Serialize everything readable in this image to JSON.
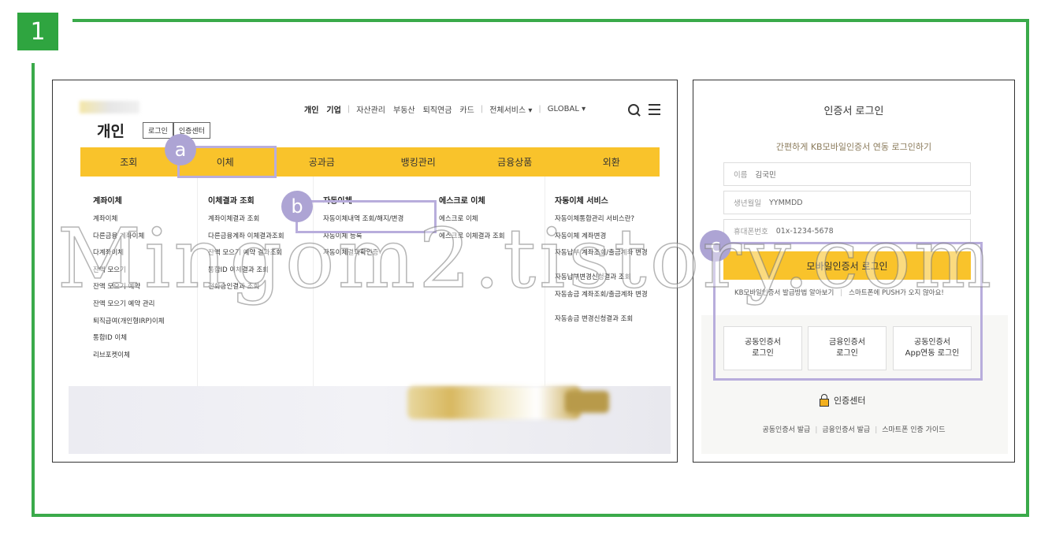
{
  "step": "1",
  "left": {
    "page_title": "개인",
    "header_buttons": [
      "로그인",
      "인증센터"
    ],
    "topnav": [
      "개인",
      "기업",
      "자산관리",
      "부동산",
      "퇴직연금",
      "카드",
      "전체서비스 ▾",
      "GLOBAL ▾"
    ],
    "mainnav": [
      "조회",
      "이체",
      "공과금",
      "뱅킹관리",
      "금융상품",
      "외환"
    ],
    "menu": [
      {
        "title": "계좌이체",
        "items": [
          "계좌이체",
          "다른금융 계좌이체",
          "다계좌이체",
          "잔액 모으기",
          "잔액 모으기 예약",
          "잔액 모으기 예약 관리",
          "퇴직급여(개인형IRP)이체",
          "통합ID 이체",
          "리브포켓이체"
        ]
      },
      {
        "title": "이체결과 조회",
        "items": [
          "계좌이체결과 조회",
          "다른금융계좌 이체결과조회",
          "잔액 모으기 예약 결과조회",
          "통합ID 이체결과 조회",
          "전화승인결과 조회"
        ]
      },
      {
        "title": "자동이체",
        "items": [
          "자동이체내역 조회/해지/변경",
          "자동이체 등록",
          "자동이체결과확인증"
        ]
      },
      {
        "title": "에스크로 이체",
        "items": [
          "에스크로 이체",
          "에스크로 이체결과 조회"
        ]
      },
      {
        "title": "자동이체 서비스",
        "items": [
          "자동이체통합관리 서비스란?",
          "자동이체 계좌변경",
          "자동납부 계좌조회/출금계좌 변경",
          "자동납부변경신청결과 조회",
          "자동송금 계좌조회/출금계좌 변경",
          "자동송금 변경신청결과 조회"
        ]
      }
    ],
    "badges": {
      "a": "a",
      "b": "b"
    }
  },
  "right": {
    "title": "인증서 로그인",
    "subtitle": "간편하게 KB모바일인증서 연동 로그인하기",
    "fields": [
      {
        "label": "이름",
        "value": "김국민"
      },
      {
        "label": "생년월일",
        "value": "YYMMDD"
      },
      {
        "label": "휴대폰번호",
        "value": "01x-1234-5678"
      }
    ],
    "login_button": "모바일인증서 로그인",
    "help_links": [
      "KB모바일인증서 발급방법 알아보기",
      "스마트폰에 PUSH가 오지 않아요!"
    ],
    "cert_buttons": [
      "공동인증서\n로그인",
      "금융인증서\n로그인",
      "공동인증서\nApp연동 로그인"
    ],
    "cert_center": "인증센터",
    "bottom_links": [
      "공동인증서 발급",
      "금융인증서 발급",
      "스마트폰 인증 가이드"
    ],
    "badge_c": "c"
  },
  "watermark": "Mingom2.tistory.com",
  "colors": {
    "accent_yellow": "#f9c32b",
    "frame_green": "#3aaa4a",
    "highlight_purple": "#ada4d4"
  }
}
